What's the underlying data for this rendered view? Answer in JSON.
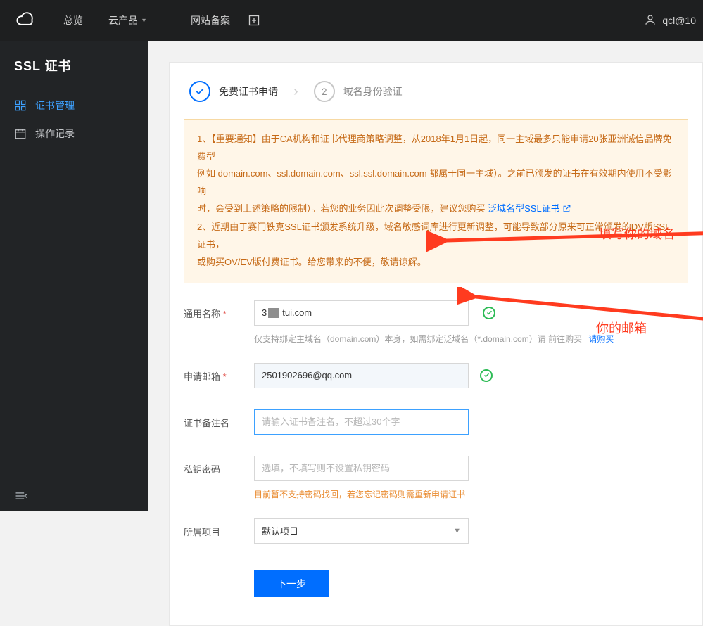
{
  "topbar": {
    "overview": "总览",
    "cloud_products": "云产品",
    "site_filing": "网站备案",
    "username": "qcl@10"
  },
  "sidebar": {
    "title": "SSL 证书",
    "items": [
      {
        "label": "证书管理"
      },
      {
        "label": "操作记录"
      }
    ]
  },
  "steps": {
    "step1": "免费证书申请",
    "step2": "域名身份验证",
    "step2_num": "2"
  },
  "notice": {
    "line1a": "1、【重要通知】由于CA机构和证书代理商策略调整，从2018年1月1日起，同一主域最多只能申请20张亚洲诚信品牌免费型",
    "line1b": "例如 domain.com、ssl.domain.com、ssl.ssl.domain.com 都属于同一主域）。之前已颁发的证书在有效期内使用不受影响",
    "line1c_prefix": "时，会受到上述策略的限制）。若您的业务因此次调整受限，建议您购买 ",
    "line1c_link": "泛域名型SSL证书",
    "line2a": "2、近期由于赛门铁克SSL证书颁发系统升级，域名敏感词库进行更新调整，可能导致部分原来可正常颁发的DV版SSL证书，",
    "line2b": "或购买OV/EV版付费证书。给您带来的不便，敬请谅解。"
  },
  "form": {
    "common_name": {
      "label": "通用名称",
      "value_prefix": "3",
      "value_suffix": "tui.com",
      "hint_text": "仅支持绑定主域名（domain.com）本身，如需绑定泛域名（*.domain.com）请 前往购买",
      "hint_link": "请购买"
    },
    "email": {
      "label": "申请邮箱",
      "value": "2501902696@qq.com"
    },
    "remark": {
      "label": "证书备注名",
      "placeholder": "请输入证书备注名，不超过30个字"
    },
    "password": {
      "label": "私钥密码",
      "placeholder": "选填，不填写则不设置私钥密码",
      "warning": "目前暂不支持密码找回，若您忘记密码则需重新申请证书"
    },
    "project": {
      "label": "所属项目",
      "value": "默认项目"
    },
    "submit": "下一步"
  },
  "annotations": {
    "domain_hint": "填写你的域名",
    "email_hint": "你的邮箱"
  }
}
